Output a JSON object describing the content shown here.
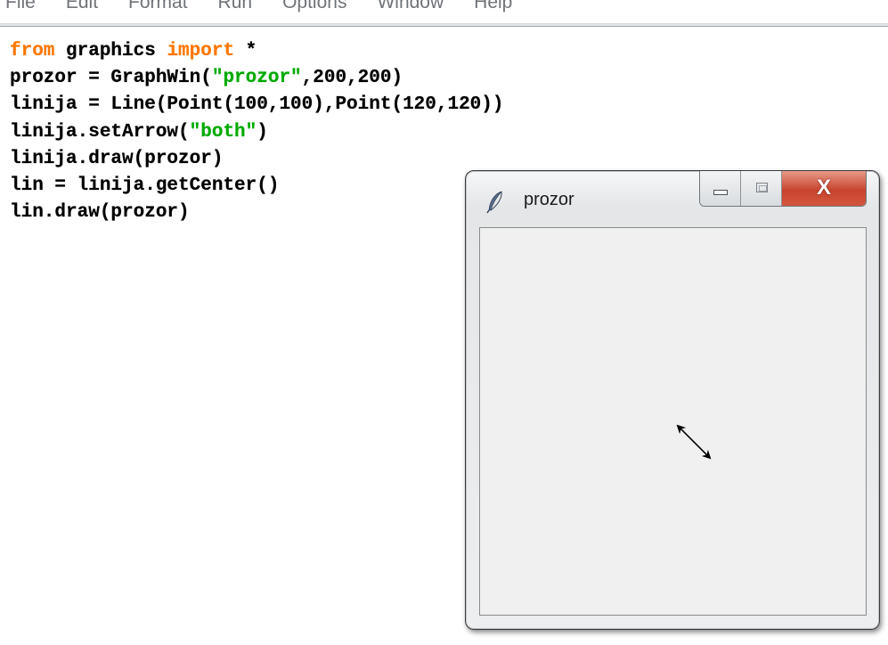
{
  "menubar": {
    "items": [
      "File",
      "Edit",
      "Format",
      "Run",
      "Options",
      "Window",
      "Help"
    ]
  },
  "editor": {
    "lines": [
      [
        {
          "t": "from",
          "c": "kw"
        },
        {
          "t": " graphics ",
          "c": ""
        },
        {
          "t": "import",
          "c": "kw"
        },
        {
          "t": " *",
          "c": ""
        }
      ],
      [
        {
          "t": "prozor = GraphWin(",
          "c": ""
        },
        {
          "t": "\"prozor\"",
          "c": "str"
        },
        {
          "t": ",200,200)",
          "c": ""
        }
      ],
      [
        {
          "t": "linija = Line(Point(100,100),Point(120,120))",
          "c": ""
        }
      ],
      [
        {
          "t": "linija.setArrow(",
          "c": ""
        },
        {
          "t": "\"both\"",
          "c": "str"
        },
        {
          "t": ")",
          "c": ""
        }
      ],
      [
        {
          "t": "linija.draw(prozor)",
          "c": ""
        }
      ],
      [
        {
          "t": "lin = linija.getCenter()",
          "c": ""
        }
      ],
      [
        {
          "t": "lin.draw(prozor)",
          "c": ""
        }
      ]
    ]
  },
  "tk_window": {
    "title": "prozor",
    "icon": "feather-icon",
    "controls": {
      "minimize_icon": "minimize-icon",
      "maximize_icon": "maximize-icon",
      "close_label": "X"
    },
    "canvas": {
      "background": "#f0f0f0",
      "line_arrow": "both"
    }
  }
}
